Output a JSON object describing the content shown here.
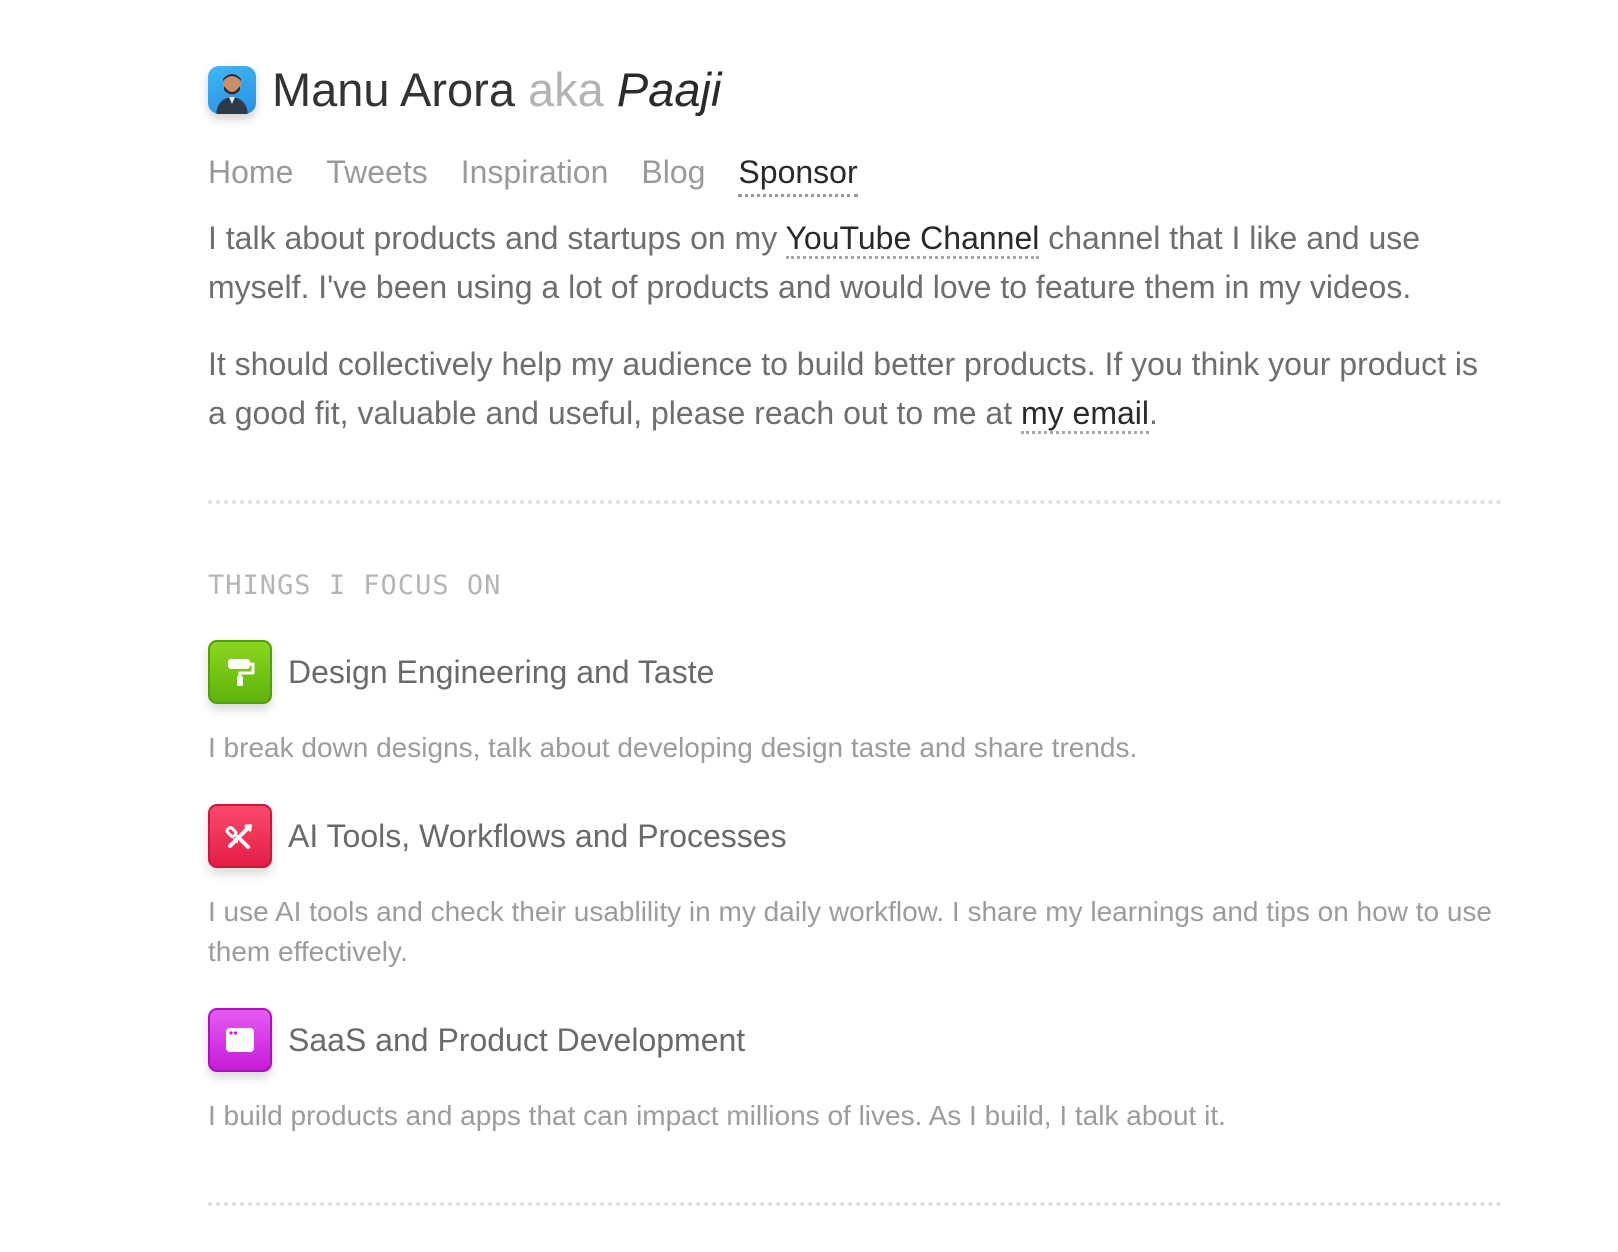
{
  "header": {
    "name": "Manu Arora",
    "aka": "aka",
    "nickname": "Paaji"
  },
  "nav": {
    "items": [
      {
        "label": "Home",
        "active": false
      },
      {
        "label": "Tweets",
        "active": false
      },
      {
        "label": "Inspiration",
        "active": false
      },
      {
        "label": "Blog",
        "active": false
      },
      {
        "label": "Sponsor",
        "active": true
      }
    ]
  },
  "intro": {
    "p1_before": "I talk about products and startups on my ",
    "p1_link": "YouTube Channel",
    "p1_after": " channel that I like and use myself. I've been using a lot of products and would love to feature them in my videos.",
    "p2_before": "It should collectively help my audience to build better products. If you think your product is a good fit, valuable and useful, please reach out to me at ",
    "p2_link": "my email",
    "p2_after": "."
  },
  "focus": {
    "heading": "THINGS I FOCUS ON",
    "items": [
      {
        "title": "Design Engineering and Taste",
        "description": "I break down designs, talk about developing design taste and share trends.",
        "icon": "paint-roller-icon",
        "color": "#6cc014"
      },
      {
        "title": "AI Tools, Workflows and Processes",
        "description": "I use AI tools and check their usablility in my daily workflow. I share my learnings and tips on how to use them effectively.",
        "icon": "tools-icon",
        "color": "#f0304f"
      },
      {
        "title": "SaaS and Product Development",
        "description": "I build products and apps that can impact millions of lives. As I build, I talk about it.",
        "icon": "browser-window-icon",
        "color": "#d22ae3"
      }
    ]
  }
}
